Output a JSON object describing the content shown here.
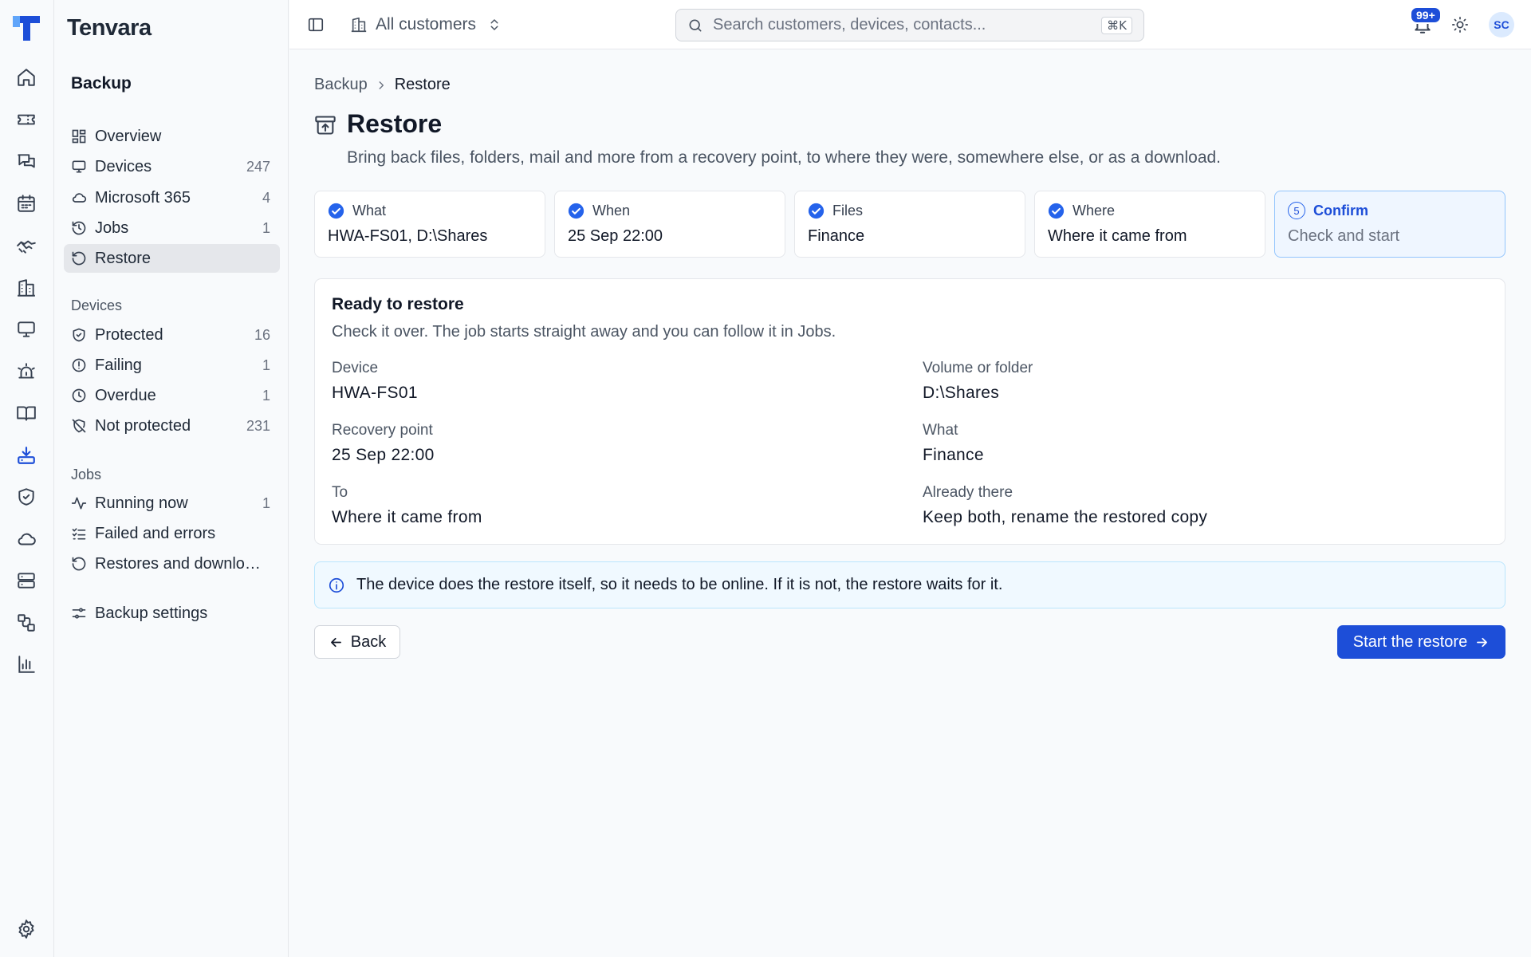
{
  "app": {
    "brand": "Tenvara"
  },
  "colors": {
    "accent": "#1d4ed8",
    "check": "#2563eb",
    "info_bg": "#f0f9ff"
  },
  "rail": {
    "items": [
      {
        "icon": "home-icon"
      },
      {
        "icon": "ticket-icon"
      },
      {
        "icon": "chat-icon"
      },
      {
        "icon": "calendar-icon"
      },
      {
        "icon": "handshake-icon"
      },
      {
        "icon": "building-icon"
      },
      {
        "icon": "monitor-icon"
      },
      {
        "icon": "alarm-icon"
      },
      {
        "icon": "book-icon"
      },
      {
        "icon": "backup-icon",
        "active": true
      },
      {
        "icon": "shield-icon"
      },
      {
        "icon": "cloud-icon"
      },
      {
        "icon": "server-icon"
      },
      {
        "icon": "workflow-icon"
      },
      {
        "icon": "reports-icon"
      },
      {
        "icon": "settings-icon"
      }
    ]
  },
  "sidebar": {
    "title": "Backup",
    "items": [
      {
        "label": "Overview",
        "count": "",
        "icon": "grid-icon"
      },
      {
        "label": "Devices",
        "count": "247",
        "icon": "monitor-icon"
      },
      {
        "label": "Microsoft 365",
        "count": "4",
        "icon": "cloud-icon"
      },
      {
        "label": "Jobs",
        "count": "1",
        "icon": "history-icon"
      },
      {
        "label": "Restore",
        "count": "",
        "icon": "restore-icon",
        "active": true
      }
    ],
    "groups": [
      {
        "title": "Devices",
        "items": [
          {
            "label": "Protected",
            "count": "16",
            "icon": "shield-check-icon"
          },
          {
            "label": "Failing",
            "count": "1",
            "icon": "alert-circle-icon"
          },
          {
            "label": "Overdue",
            "count": "1",
            "icon": "clock-icon"
          },
          {
            "label": "Not protected",
            "count": "231",
            "icon": "shield-off-icon"
          }
        ]
      },
      {
        "title": "Jobs",
        "items": [
          {
            "label": "Running now",
            "count": "1",
            "icon": "activity-icon"
          },
          {
            "label": "Failed and errors",
            "count": "",
            "icon": "list-check-icon"
          },
          {
            "label": "Restores and downloads",
            "count": "",
            "icon": "restore-icon"
          }
        ]
      }
    ],
    "settings": {
      "label": "Backup settings",
      "icon": "sliders-icon"
    }
  },
  "topbar": {
    "customer_selector": "All customers",
    "search": {
      "placeholder": "Search customers, devices, contacts...",
      "shortcut": "⌘K"
    },
    "notifications_badge": "99+",
    "avatar_initials": "SC"
  },
  "breadcrumb": [
    "Backup",
    "Restore"
  ],
  "page": {
    "title": "Restore",
    "subtitle": "Bring back files, folders, mail and more from a recovery point, to where they were, somewhere else, or as a download."
  },
  "steps": [
    {
      "label": "What",
      "value": "HWA-FS01, D:\\Shares",
      "state": "done"
    },
    {
      "label": "When",
      "value": "25 Sep 22:00",
      "state": "done"
    },
    {
      "label": "Files",
      "value": "Finance",
      "state": "done"
    },
    {
      "label": "Where",
      "value": "Where it came from",
      "state": "done"
    },
    {
      "label": "Confirm",
      "value": "Check and start",
      "state": "current",
      "number": "5"
    }
  ],
  "summary": {
    "title": "Ready to restore",
    "subtitle": "Check it over. The job starts straight away and you can follow it in Jobs.",
    "fields": [
      {
        "label": "Device",
        "value": "HWA-FS01"
      },
      {
        "label": "Volume or folder",
        "value": "D:\\Shares"
      },
      {
        "label": "Recovery point",
        "value": "25 Sep 22:00"
      },
      {
        "label": "What",
        "value": "Finance"
      },
      {
        "label": "To",
        "value": "Where it came from"
      },
      {
        "label": "Already there",
        "value": "Keep both, rename the restored copy"
      }
    ]
  },
  "notice": "The device does the restore itself, so it needs to be online. If it is not, the restore waits for it.",
  "actions": {
    "back": "Back",
    "start": "Start the restore"
  }
}
